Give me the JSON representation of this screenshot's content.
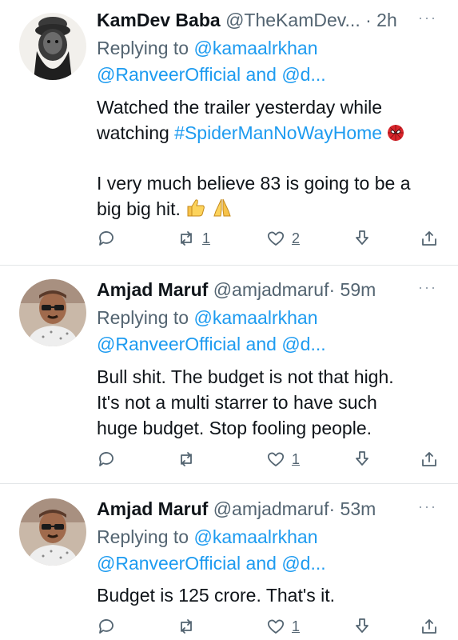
{
  "tweets": [
    {
      "name": "KamDev Baba",
      "handle": "@TheKamDev...",
      "dot": "·",
      "time": "2h",
      "more": "···",
      "replying_prefix": "Replying to ",
      "reply_mention1": "@kamaalrkhan",
      "reply_mention2": "@RanveerOfficial",
      "reply_and": " and @d...",
      "body_line1": "Watched the trailer yesterday while",
      "body_line2_text": "watching ",
      "body_line2_hashtag": "#SpiderManNoWayHome",
      "body_line3": "I very much believe 83 is going to be a",
      "body_line4": "big big hit.",
      "emoji_names": [
        "spider-man-mask-icon",
        "thumbs-up-icon",
        "folded-hands-icon"
      ],
      "retweets": "1",
      "likes": "2"
    },
    {
      "name": "Amjad Maruf",
      "handle": "@amjadmaruf",
      "dot": "·",
      "time": "59m",
      "more": "···",
      "replying_prefix": "Replying to ",
      "reply_mention1": "@kamaalrkhan",
      "reply_mention2": "@RanveerOfficial",
      "reply_and": " and @d...",
      "body_line1": "Bull shit. The budget is not that high.",
      "body_line2": "It's not a multi starrer to have such",
      "body_line3": "huge budget. Stop fooling people.",
      "likes": "1"
    },
    {
      "name": "Amjad Maruf",
      "handle": "@amjadmaruf",
      "dot": "·",
      "time": "53m",
      "more": "···",
      "replying_prefix": "Replying to ",
      "reply_mention1": "@kamaalrkhan",
      "reply_mention2": "@RanveerOfficial",
      "reply_and": " and @d...",
      "body_line1": "Budget is 125 crore. That's it.",
      "likes": "1"
    }
  ],
  "colors": {
    "link": "#1d9bf0",
    "secondary_text": "#536471",
    "primary_text": "#0f1419",
    "divider": "#e3e6e8"
  }
}
